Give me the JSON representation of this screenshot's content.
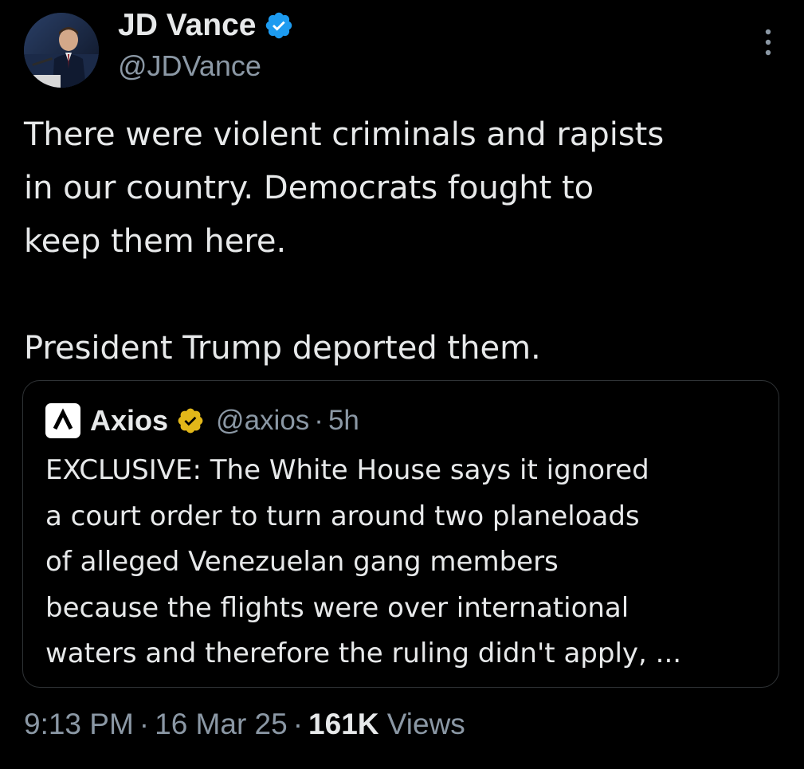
{
  "author": {
    "display_name": "JD Vance",
    "handle": "@JDVance",
    "verified_badge": "blue-check-icon",
    "avatar": "profile-photo"
  },
  "tweet": {
    "lines": [
      "There were violent criminals and rapists",
      "in our country. Democrats fought to",
      "keep them here."
    ],
    "lines_2": [
      "President Trump deported them."
    ]
  },
  "quote": {
    "logo": "axios-logo",
    "display_name": "Axios",
    "verified_badge": "gold-check-icon",
    "handle": "@axios",
    "separator": "·",
    "time": "5h",
    "lines": [
      "EXCLUSIVE: The White House says it ignored",
      "a court order to turn around two planeloads",
      "of alleged Venezuelan gang members",
      "because the flights were over international",
      "waters and therefore the ruling didn't apply, ..."
    ]
  },
  "meta": {
    "time": "9:13 PM",
    "separator": "·",
    "date": "16 Mar 25",
    "views_count": "161K",
    "views_label": "Views"
  },
  "colors": {
    "background": "#000000",
    "text_primary": "#e7e9ea",
    "text_secondary": "#8b98a5",
    "verified_blue": "#1d9bf0",
    "verified_gold": "#e2b719",
    "border": "#2f3336"
  }
}
